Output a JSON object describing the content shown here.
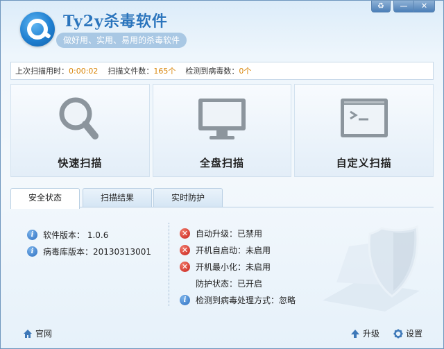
{
  "app": {
    "title": "Ty2y杀毒软件",
    "subtitle": "做好用、实用、易用的杀毒软件"
  },
  "window_controls": {
    "skin": "♻",
    "minimize": "—",
    "close": "✕"
  },
  "stats": {
    "last_scan_label": "上次扫描用时：",
    "last_scan_value": "0:00:02",
    "files_label": "扫描文件数：",
    "files_value": "165个",
    "virus_label": "检测到病毒数：",
    "virus_value": "0个"
  },
  "scan": {
    "quick": "快速扫描",
    "full": "全盘扫描",
    "custom": "自定义扫描"
  },
  "tabs": {
    "security": "安全状态",
    "results": "扫描结果",
    "realtime": "实时防护"
  },
  "info": {
    "software_version": "软件版本： 1.0.6",
    "db_version": "病毒库版本：20130313001"
  },
  "status": {
    "auto_update": "自动升级：已禁用",
    "auto_start": "开机自启动：未启用",
    "start_minimized": "开机最小化：未启用",
    "protection": "防护状态：已开启",
    "virus_action": "检测到病毒处理方式：忽略"
  },
  "footer": {
    "website": "官网",
    "upgrade": "升级",
    "settings": "设置"
  },
  "colors": {
    "accent": "#2b75bd",
    "highlight_value": "#d8860a",
    "error": "#c8211b",
    "info": "#2d6fc1"
  }
}
